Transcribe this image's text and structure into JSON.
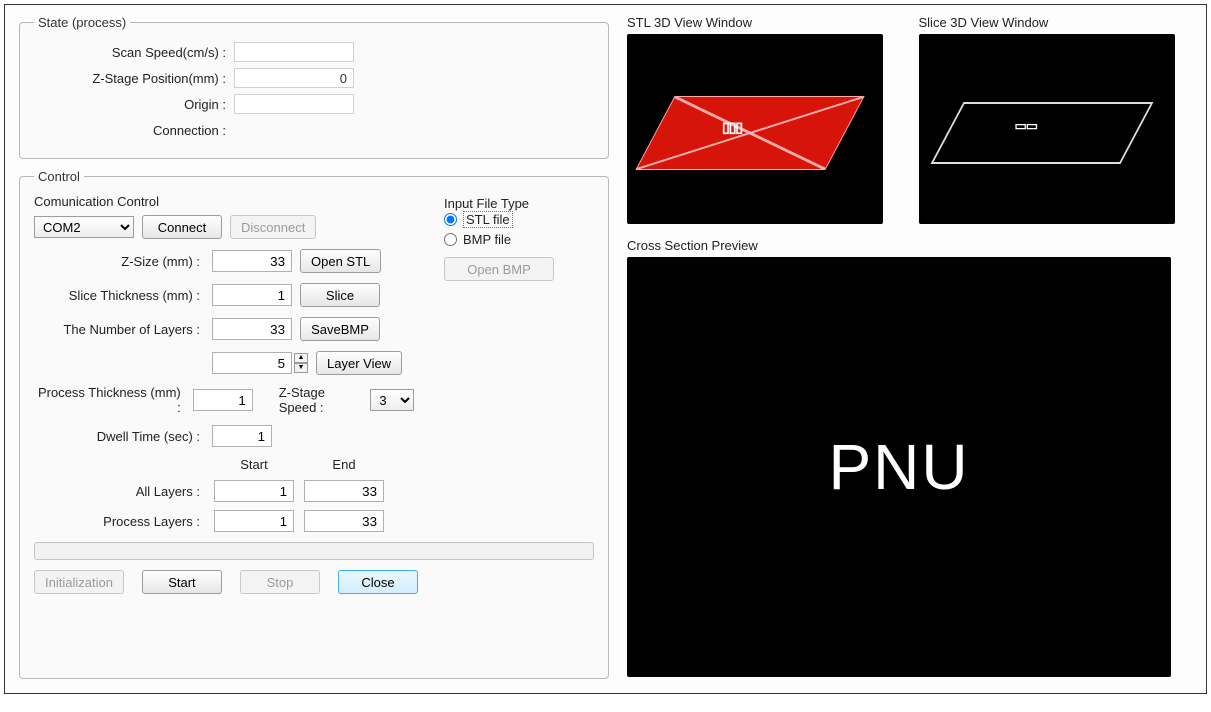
{
  "state": {
    "legend": "State (process)",
    "rows": {
      "scan_speed": {
        "label": "Scan Speed(cm/s) :",
        "value": ""
      },
      "z_stage": {
        "label": "Z-Stage Position(mm) :",
        "value": "0"
      },
      "origin": {
        "label": "Origin :",
        "value": ""
      },
      "connection": {
        "label": "Connection :",
        "value": ""
      }
    }
  },
  "control": {
    "legend": "Control",
    "comm_title": "Comunication Control",
    "com_port": "COM2",
    "connect_btn": "Connect",
    "disconnect_btn": "Disconnect",
    "z_size_label": "Z-Size (mm) :",
    "z_size": "33",
    "open_stl_btn": "Open STL",
    "slice_thick_label": "Slice Thickness (mm) :",
    "slice_thick": "1",
    "slice_btn": "Slice",
    "num_layers_label": "The Number of Layers :",
    "num_layers": "33",
    "save_bmp_btn": "SaveBMP",
    "layer_index": "5",
    "layer_view_btn": "Layer View",
    "proc_thick_label": "Process Thickness (mm) :",
    "proc_thick": "1",
    "z_stage_speed_label": "Z-Stage Speed :",
    "z_stage_speed": "3",
    "dwell_label": "Dwell Time (sec) :",
    "dwell": "1",
    "start_col": "Start",
    "end_col": "End",
    "all_layers_label": "All Layers :",
    "all_layers_start": "1",
    "all_layers_end": "33",
    "proc_layers_label": "Process Layers :",
    "proc_layers_start": "1",
    "proc_layers_end": "33"
  },
  "input_file": {
    "legend": "Input File Type",
    "stl_label": "STL file",
    "bmp_label": "BMP file",
    "open_bmp_btn": "Open BMP",
    "selected": "stl"
  },
  "bottom": {
    "init_btn": "Initialization",
    "start_btn": "Start",
    "stop_btn": "Stop",
    "close_btn": "Close"
  },
  "views": {
    "stl_title": "STL 3D View Window",
    "slice_title": "Slice 3D View Window",
    "cross_title": "Cross Section Preview",
    "cross_text": "PNU",
    "stl_glyph": "▯▯▯",
    "slice_glyph": "▭▭"
  }
}
